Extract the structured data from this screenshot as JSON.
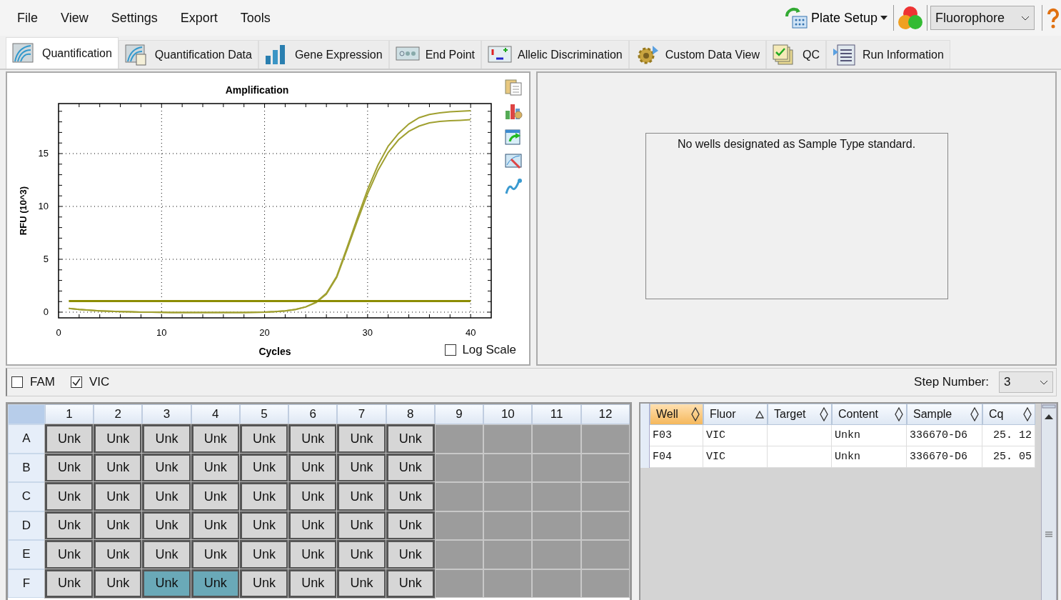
{
  "menu": [
    "File",
    "View",
    "Settings",
    "Export",
    "Tools"
  ],
  "toolbar": {
    "plate_setup": "Plate Setup",
    "fluorophore": "Fluorophore"
  },
  "tabs": [
    {
      "label": "Quantification",
      "selected": true
    },
    {
      "label": "Quantification Data",
      "selected": false
    },
    {
      "label": "Gene Expression",
      "selected": false
    },
    {
      "label": "End Point",
      "selected": false
    },
    {
      "label": "Allelic Discrimination",
      "selected": false
    },
    {
      "label": "Custom Data View",
      "selected": false
    },
    {
      "label": "QC",
      "selected": false
    },
    {
      "label": "Run Information",
      "selected": false
    }
  ],
  "chart": {
    "chart_data": {
      "type": "line",
      "title": "Amplification",
      "xlabel": "Cycles",
      "ylabel": "RFU (10^3)",
      "x": [
        1,
        2,
        3,
        4,
        5,
        6,
        7,
        8,
        9,
        10,
        11,
        12,
        13,
        14,
        15,
        16,
        17,
        18,
        19,
        20,
        21,
        22,
        23,
        24,
        25,
        26,
        27,
        28,
        29,
        30,
        31,
        32,
        33,
        34,
        35,
        36,
        37,
        38,
        39,
        40
      ],
      "series": [
        {
          "color": "#a0a030",
          "values": [
            0.35,
            0.25,
            0.18,
            0.12,
            0.08,
            0.05,
            0.03,
            0.01,
            0,
            -0.02,
            -0.03,
            -0.03,
            -0.03,
            -0.03,
            -0.03,
            -0.03,
            -0.03,
            -0.03,
            -0.02,
            0,
            0.05,
            0.12,
            0.25,
            0.5,
            0.95,
            1.8,
            3.4,
            6.1,
            8.9,
            11.6,
            13.9,
            15.7,
            16.9,
            17.8,
            18.4,
            18.7,
            18.85,
            18.95,
            19.0,
            19.05
          ]
        },
        {
          "color": "#a0a030",
          "values": [
            0.35,
            0.25,
            0.18,
            0.12,
            0.08,
            0.05,
            0.03,
            0.01,
            0,
            -0.02,
            -0.03,
            -0.03,
            -0.03,
            -0.03,
            -0.03,
            -0.03,
            -0.03,
            -0.03,
            -0.02,
            0,
            0.05,
            0.12,
            0.25,
            0.5,
            0.9,
            1.7,
            3.3,
            5.9,
            8.6,
            11.2,
            13.4,
            15.1,
            16.3,
            17.1,
            17.6,
            17.9,
            18.05,
            18.1,
            18.15,
            18.2
          ]
        },
        {
          "color": "#8c8c00",
          "values": [
            1.05,
            1.05,
            1.05,
            1.05,
            1.05,
            1.05,
            1.05,
            1.05,
            1.05,
            1.05,
            1.05,
            1.05,
            1.05,
            1.05,
            1.05,
            1.05,
            1.05,
            1.05,
            1.05,
            1.05,
            1.05,
            1.05,
            1.05,
            1.05,
            1.05,
            1.05,
            1.05,
            1.05,
            1.05,
            1.05,
            1.05,
            1.05,
            1.05,
            1.05,
            1.05,
            1.05,
            1.05,
            1.05,
            1.05,
            1.05
          ]
        }
      ],
      "xlim": [
        0,
        42
      ],
      "ylim": [
        -0.54,
        19.73
      ],
      "xticks": [
        0,
        10,
        20,
        30,
        40
      ],
      "yticks": [
        0,
        5,
        10,
        15
      ],
      "grid": true
    },
    "log_scale": {
      "label": "Log Scale",
      "checked": false
    }
  },
  "standard_curve": {
    "message": "No wells designated as Sample Type standard."
  },
  "channels": [
    {
      "label": "FAM",
      "checked": false
    },
    {
      "label": "VIC",
      "checked": true
    }
  ],
  "step_number": {
    "label": "Step Number:",
    "value": "3"
  },
  "plate": {
    "columns": [
      "1",
      "2",
      "3",
      "4",
      "5",
      "6",
      "7",
      "8",
      "9",
      "10",
      "11",
      "12"
    ],
    "rows": [
      {
        "label": "A",
        "wells": [
          {
            "kind": "sample",
            "label": "Unk",
            "selected": false
          },
          {
            "kind": "sample",
            "label": "Unk",
            "selected": false
          },
          {
            "kind": "sample",
            "label": "Unk",
            "selected": false
          },
          {
            "kind": "sample",
            "label": "Unk",
            "selected": false
          },
          {
            "kind": "sample",
            "label": "Unk",
            "selected": false
          },
          {
            "kind": "sample",
            "label": "Unk",
            "selected": false
          },
          {
            "kind": "sample",
            "label": "Unk",
            "selected": false
          },
          {
            "kind": "sample",
            "label": "Unk",
            "selected": false
          },
          {
            "kind": "empty"
          },
          {
            "kind": "empty"
          },
          {
            "kind": "empty"
          },
          {
            "kind": "empty"
          }
        ]
      },
      {
        "label": "B",
        "wells": [
          {
            "kind": "sample",
            "label": "Unk",
            "selected": false
          },
          {
            "kind": "sample",
            "label": "Unk",
            "selected": false
          },
          {
            "kind": "sample",
            "label": "Unk",
            "selected": false
          },
          {
            "kind": "sample",
            "label": "Unk",
            "selected": false
          },
          {
            "kind": "sample",
            "label": "Unk",
            "selected": false
          },
          {
            "kind": "sample",
            "label": "Unk",
            "selected": false
          },
          {
            "kind": "sample",
            "label": "Unk",
            "selected": false
          },
          {
            "kind": "sample",
            "label": "Unk",
            "selected": false
          },
          {
            "kind": "empty"
          },
          {
            "kind": "empty"
          },
          {
            "kind": "empty"
          },
          {
            "kind": "empty"
          }
        ]
      },
      {
        "label": "C",
        "wells": [
          {
            "kind": "sample",
            "label": "Unk",
            "selected": false
          },
          {
            "kind": "sample",
            "label": "Unk",
            "selected": false
          },
          {
            "kind": "sample",
            "label": "Unk",
            "selected": false
          },
          {
            "kind": "sample",
            "label": "Unk",
            "selected": false
          },
          {
            "kind": "sample",
            "label": "Unk",
            "selected": false
          },
          {
            "kind": "sample",
            "label": "Unk",
            "selected": false
          },
          {
            "kind": "sample",
            "label": "Unk",
            "selected": false
          },
          {
            "kind": "sample",
            "label": "Unk",
            "selected": false
          },
          {
            "kind": "empty"
          },
          {
            "kind": "empty"
          },
          {
            "kind": "empty"
          },
          {
            "kind": "empty"
          }
        ]
      },
      {
        "label": "D",
        "wells": [
          {
            "kind": "sample",
            "label": "Unk",
            "selected": false
          },
          {
            "kind": "sample",
            "label": "Unk",
            "selected": false
          },
          {
            "kind": "sample",
            "label": "Unk",
            "selected": false
          },
          {
            "kind": "sample",
            "label": "Unk",
            "selected": false
          },
          {
            "kind": "sample",
            "label": "Unk",
            "selected": false
          },
          {
            "kind": "sample",
            "label": "Unk",
            "selected": false
          },
          {
            "kind": "sample",
            "label": "Unk",
            "selected": false
          },
          {
            "kind": "sample",
            "label": "Unk",
            "selected": false
          },
          {
            "kind": "empty"
          },
          {
            "kind": "empty"
          },
          {
            "kind": "empty"
          },
          {
            "kind": "empty"
          }
        ]
      },
      {
        "label": "E",
        "wells": [
          {
            "kind": "sample",
            "label": "Unk",
            "selected": false
          },
          {
            "kind": "sample",
            "label": "Unk",
            "selected": false
          },
          {
            "kind": "sample",
            "label": "Unk",
            "selected": false
          },
          {
            "kind": "sample",
            "label": "Unk",
            "selected": false
          },
          {
            "kind": "sample",
            "label": "Unk",
            "selected": false
          },
          {
            "kind": "sample",
            "label": "Unk",
            "selected": false
          },
          {
            "kind": "sample",
            "label": "Unk",
            "selected": false
          },
          {
            "kind": "sample",
            "label": "Unk",
            "selected": false
          },
          {
            "kind": "empty"
          },
          {
            "kind": "empty"
          },
          {
            "kind": "empty"
          },
          {
            "kind": "empty"
          }
        ]
      },
      {
        "label": "F",
        "wells": [
          {
            "kind": "sample",
            "label": "Unk",
            "selected": false
          },
          {
            "kind": "sample",
            "label": "Unk",
            "selected": false
          },
          {
            "kind": "sample",
            "label": "Unk",
            "selected": true
          },
          {
            "kind": "sample",
            "label": "Unk",
            "selected": true
          },
          {
            "kind": "sample",
            "label": "Unk",
            "selected": false
          },
          {
            "kind": "sample",
            "label": "Unk",
            "selected": false
          },
          {
            "kind": "sample",
            "label": "Unk",
            "selected": false
          },
          {
            "kind": "sample",
            "label": "Unk",
            "selected": false
          },
          {
            "kind": "empty"
          },
          {
            "kind": "empty"
          },
          {
            "kind": "empty"
          },
          {
            "kind": "empty"
          }
        ]
      }
    ]
  },
  "table": {
    "columns": [
      {
        "label": "Well",
        "sorted_ascending": false,
        "selected": true
      },
      {
        "label": "Fluor",
        "sorted_ascending": true,
        "selected": false
      },
      {
        "label": "Target",
        "sorted_ascending": false,
        "selected": false
      },
      {
        "label": "Content",
        "sorted_ascending": false,
        "selected": false
      },
      {
        "label": "Sample",
        "sorted_ascending": false,
        "selected": false
      },
      {
        "label": "Cq",
        "sorted_ascending": false,
        "selected": false
      }
    ],
    "rows": [
      [
        "F03",
        "VIC",
        null,
        "Unkn",
        "336670-D6",
        "25. 12"
      ],
      [
        "F04",
        "VIC",
        null,
        "Unkn",
        "336670-D6",
        "25. 05"
      ]
    ]
  }
}
